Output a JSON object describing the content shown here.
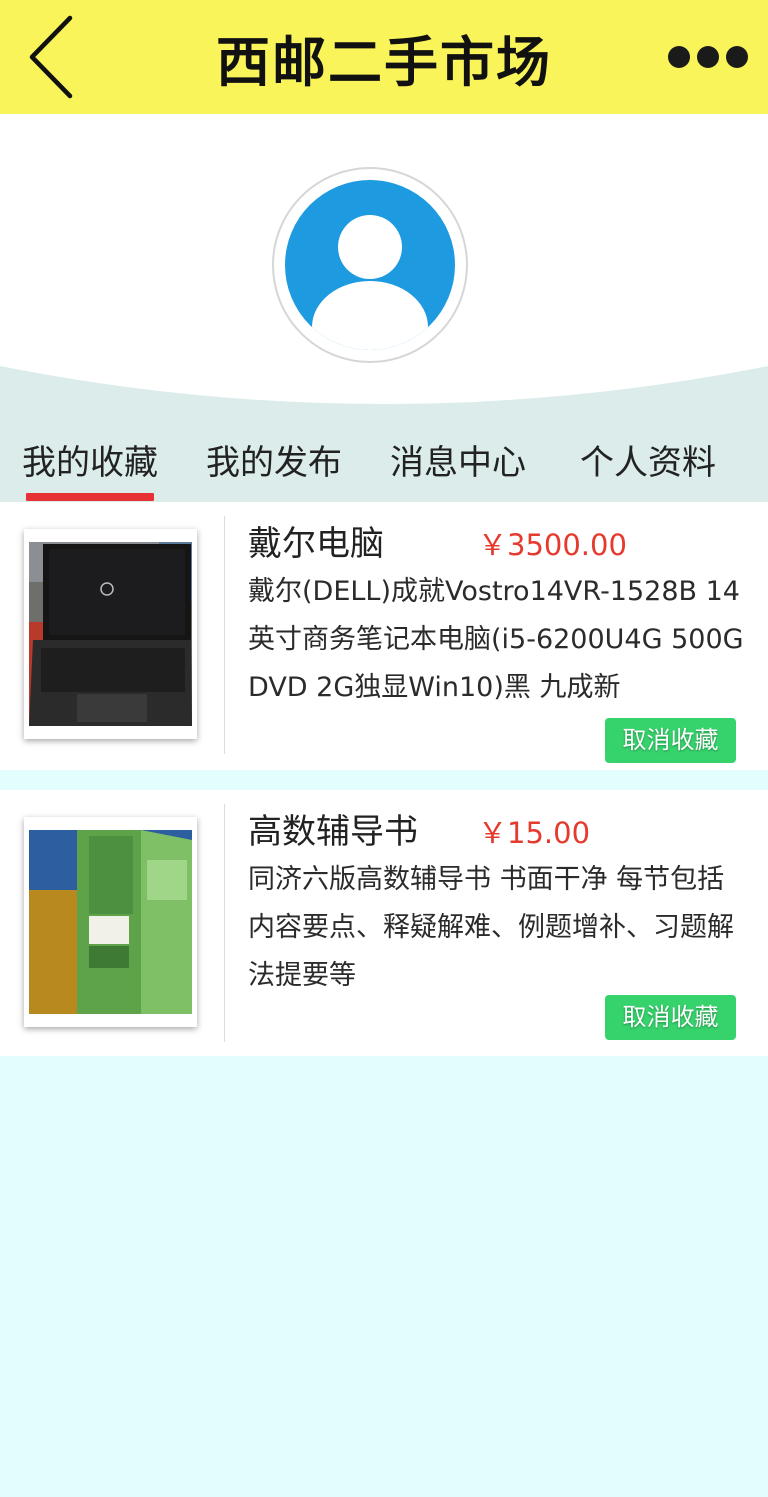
{
  "header": {
    "title": "西邮二手市场"
  },
  "tabs": [
    {
      "label": "我的收藏",
      "active": true
    },
    {
      "label": "我的发布",
      "active": false
    },
    {
      "label": "消息中心",
      "active": false
    },
    {
      "label": "个人资料",
      "active": false
    }
  ],
  "items": [
    {
      "name": "戴尔电脑",
      "price": "￥3500.00",
      "description": "戴尔(DELL)成就Vostro14VR-1528B 14英寸商务笔记本电脑(i5-6200U4G 500G DVD 2G独显Win10)黑 九成新",
      "action": "取消收藏"
    },
    {
      "name": "高数辅导书",
      "price": "￥15.00",
      "description": "同济六版高数辅导书 书面干净  每节包括内容要点、释疑解难、例题增补、习题解法提要等",
      "action": "取消收藏"
    }
  ],
  "colors": {
    "header_bg": "#f8f45a",
    "tab_band": "#dbeceb",
    "active_tab_underline": "#e63232",
    "price": "#e53a2e",
    "action_button": "#36d36c",
    "page_bg": "#e3fcfc",
    "avatar_blue": "#1e9ae0"
  },
  "icons": {
    "back": "chevron-left-icon",
    "more": "more-dots-icon",
    "avatar": "user-avatar-icon"
  }
}
